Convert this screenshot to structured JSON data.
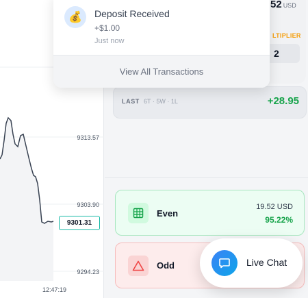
{
  "chart": {
    "y_labels": [
      "9313.57",
      "9303.90",
      "9294.23"
    ],
    "current_price": "9301.31",
    "time_label": "12:47:19",
    "line_color": "#374151"
  },
  "stake": {
    "amount": "52",
    "currency": "USD",
    "multiplier_label": "LTIPLIER",
    "multiplier_value": "2"
  },
  "last": {
    "title": "LAST",
    "summary": "6T · 5W · 1L",
    "value": "+28.95"
  },
  "even": {
    "label": "Even",
    "amount": "19.52 USD",
    "percent": "95.22%",
    "icon": "grid-icon"
  },
  "odd": {
    "label": "Odd",
    "icon": "triangle-icon"
  },
  "notification": {
    "icon": "money-bag-icon",
    "title": "Deposit Received",
    "amount": "+$1.00",
    "time": "Just now",
    "footer": "View All Transactions"
  },
  "chat": {
    "label": "Live Chat",
    "icon": "chat-bubble-icon"
  },
  "colors": {
    "positive": "#16a34a",
    "accent": "#14b8a6",
    "warning": "#f59e0b"
  }
}
